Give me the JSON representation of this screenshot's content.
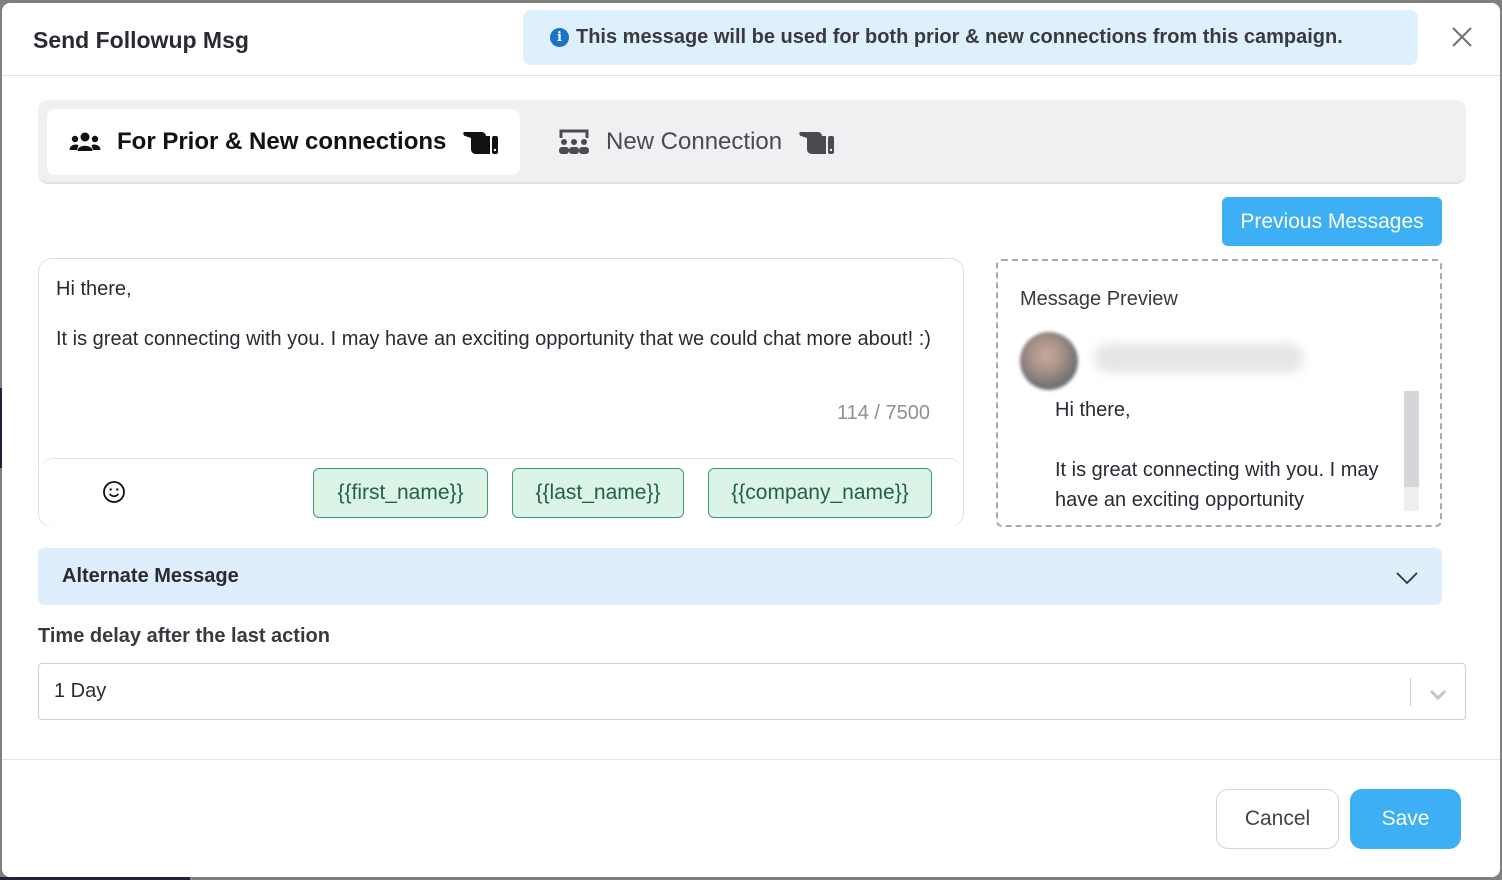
{
  "header": {
    "title": "Send Followup Msg",
    "info_banner": "This message will be used for both prior & new connections from this campaign.",
    "info_icon": "info-icon",
    "close_icon": "close-icon"
  },
  "tabs": [
    {
      "label": "For Prior & New connections",
      "icon": "users-group-icon",
      "hint_icon": "pointing-hand-icon",
      "active": true
    },
    {
      "label": "New Connection",
      "icon": "network-people-icon",
      "hint_icon": "pointing-hand-icon",
      "active": false
    }
  ],
  "previous_messages_label": "Previous Messages",
  "editor": {
    "text": "Hi there,\n\nIt is great connecting with you. I may have an exciting opportunity that we could chat more about! :)",
    "char_count": "114 / 7500",
    "emoji_icon": "smiley-icon",
    "variables": [
      "{{first_name}}",
      "{{last_name}}",
      "{{company_name}}"
    ]
  },
  "preview": {
    "title": "Message Preview",
    "body": "Hi there,\n\nIt is great connecting with you. I may have an exciting opportunity",
    "scroll_position": 0
  },
  "alternate_message": {
    "label": "Alternate Message",
    "expanded": false
  },
  "time_delay": {
    "label": "Time delay after the last action",
    "selected": "1 Day"
  },
  "footer": {
    "cancel_label": "Cancel",
    "save_label": "Save"
  },
  "colors": {
    "accent": "#3caff5",
    "banner_bg": "#dff0fd",
    "chip_bg": "#dbf4e6",
    "chip_border": "#3e9a7c",
    "info_icon": "#1a73c9"
  }
}
